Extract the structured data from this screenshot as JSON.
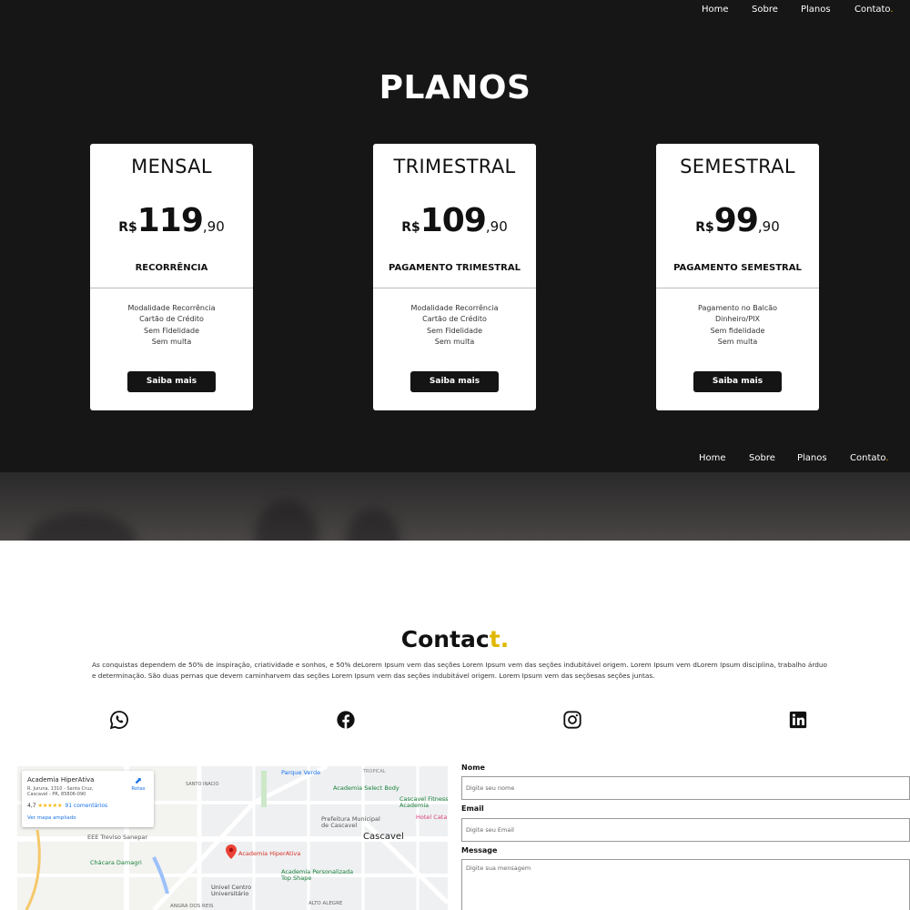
{
  "nav_top": {
    "home": "Home",
    "sobre": "Sobre",
    "planos": "Planos",
    "contato": "Contato",
    "contato_dot": "."
  },
  "nav_bottom": {
    "home": "Home",
    "sobre": "Sobre",
    "planos": "Planos",
    "contato": "Contato",
    "contato_dot": "."
  },
  "plans_title": "PLANOS",
  "plans": [
    {
      "name": "MENSAL",
      "currency": "R$",
      "price": "119",
      "cents": ",90",
      "subtitle": "RECORRÊNCIA",
      "features": [
        "Modalidade Recorrência",
        "Cartão de Crédito",
        "Sem Fidelidade",
        "Sem multa"
      ],
      "button": "Saiba mais"
    },
    {
      "name": "TRIMESTRAL",
      "currency": "R$",
      "price": "109",
      "cents": ",90",
      "subtitle": "PAGAMENTO TRIMESTRAL",
      "features": [
        "Modalidade Recorrência",
        "Cartão de Crédito",
        "Sem Fidelidade",
        "Sem multa"
      ],
      "button": "Saiba mais"
    },
    {
      "name": "SEMESTRAL",
      "currency": "R$",
      "price": "99",
      "cents": ",90",
      "subtitle": "PAGAMENTO SEMESTRAL",
      "features": [
        "Pagamento no Balcão",
        "Dinheiro/PIX",
        "Sem fidelidade",
        "Sem multa"
      ],
      "button": "Saiba mais"
    }
  ],
  "contact": {
    "title_main": "Contac",
    "title_accent": "t.",
    "text": "As conquistas dependem de 50% de inspiração, criatividade e sonhos, e 50% deLorem Ipsum vem das seções Lorem Ipsum vem das seções indubitável origem. Lorem Ipsum vem dLorem Ipsum disciplina, trabalho árduo e determinação. São duas pernas que devem caminharvem das seções Lorem Ipsum vem das seções indubitável origem. Lorem Ipsum vem das seçõesas seções juntas."
  },
  "social_icons": [
    "whatsapp-icon",
    "facebook-icon",
    "instagram-icon",
    "linkedin-icon"
  ],
  "map": {
    "place_name": "Academia HiperAtiva",
    "address": "R. Juruna, 1310 - Santa Cruz, Cascavel - PR, 85806-090",
    "rating": "4,7",
    "stars": "★★★★★",
    "reviews": "91 comentários",
    "view_larger": "Ver mapa ampliado",
    "routes": "Rotas",
    "labels": {
      "parque_verde": "Parque Verde",
      "tropical": "TROPICAL",
      "academia_select": "Academia Select Body",
      "santo_inacio": "SANTO INACIO",
      "cascavel_fitness": "Cascavel Fitness Academia",
      "prefeitura": "Prefeitura Municipal de Cascavel",
      "cascavel": "Cascavel",
      "hotel": "Hotel Cata",
      "eee_treviso": "EEE Treviso Sanepar",
      "academia_hiperativa": "Academia HiperAtiva",
      "chacara": "Chácara Damagri",
      "academia_personalizada": "Academia Personalizada Top Shape",
      "univel": "Univel Centro Universitário",
      "angra": "ANGRA DOS REIS",
      "alto_alegre": "ALTO ALEGRE"
    }
  },
  "form": {
    "name_label": "Nome",
    "name_placeholder": "Digite seu nome",
    "email_label": "Email",
    "email_placeholder": "Digite seu Email",
    "message_label": "Message",
    "message_placeholder": "Digite sua mensagem"
  },
  "colors": {
    "dark_bg": "#161616",
    "accent": "#e0b800",
    "button": "#141414"
  }
}
